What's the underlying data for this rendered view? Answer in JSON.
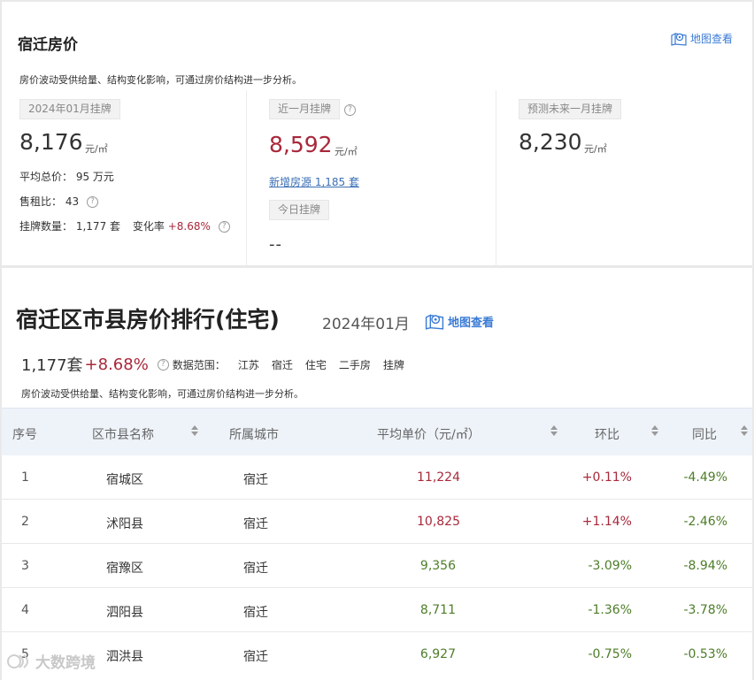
{
  "overview": {
    "title": "宿迁房价",
    "map_link": "地图查看",
    "note": "房价波动受供给量、结构变化影响，可通过房价结构进一步分析。",
    "listing": {
      "tag": "2024年01月挂牌",
      "price": "8,176",
      "unit": "元/㎡",
      "avg_total_label": "平均总价：",
      "avg_total_value": "95 万元",
      "rent_ratio_label": "售租比：",
      "rent_ratio_value": "43",
      "count_label": "挂牌数量：",
      "count_value": "1,177 套",
      "change_label": "变化率",
      "change_value": "+8.68%"
    },
    "recent": {
      "tag": "近一月挂牌",
      "price": "8,592",
      "unit": "元/㎡",
      "new_listings": "新增房源 1,185 套",
      "today_tag": "今日挂牌",
      "today_value": "--"
    },
    "forecast": {
      "tag": "预测未来一月挂牌",
      "price": "8,230",
      "unit": "元/㎡"
    }
  },
  "ranking": {
    "title": "宿迁区市县房价排行(住宅)",
    "date": "2024年01月",
    "map_link": "地图查看",
    "count": "1,177套",
    "change": "+8.68%",
    "scope_label": "数据范围：",
    "scope": [
      "江苏",
      "宿迁",
      "住宅",
      "二手房",
      "挂牌"
    ],
    "note": "房价波动受供给量、结构变化影响，可通过房价结构进一步分析。",
    "headers": {
      "index": "序号",
      "district": "区市县名称",
      "city": "所属城市",
      "price": "平均单价（元/㎡）",
      "mom": "环比",
      "yoy": "同比"
    },
    "rows": [
      {
        "index": "1",
        "district": "宿城区",
        "city": "宿迁",
        "price": "11,224",
        "mom": "+0.11%",
        "yoy": "-4.49%"
      },
      {
        "index": "2",
        "district": "沭阳县",
        "city": "宿迁",
        "price": "10,825",
        "mom": "+1.14%",
        "yoy": "-2.46%"
      },
      {
        "index": "3",
        "district": "宿豫区",
        "city": "宿迁",
        "price": "9,356",
        "mom": "-3.09%",
        "yoy": "-8.94%"
      },
      {
        "index": "4",
        "district": "泗阳县",
        "city": "宿迁",
        "price": "8,711",
        "mom": "-1.36%",
        "yoy": "-3.78%"
      },
      {
        "index": "5",
        "district": "泗洪县",
        "city": "宿迁",
        "price": "6,927",
        "mom": "-0.75%",
        "yoy": "-0.53%"
      }
    ]
  },
  "watermark": "大数跨境",
  "colors": {
    "up": "#a8283a",
    "down": "#4d7d28",
    "link": "#3a7bd5",
    "header_bg": "#eef3f9"
  }
}
